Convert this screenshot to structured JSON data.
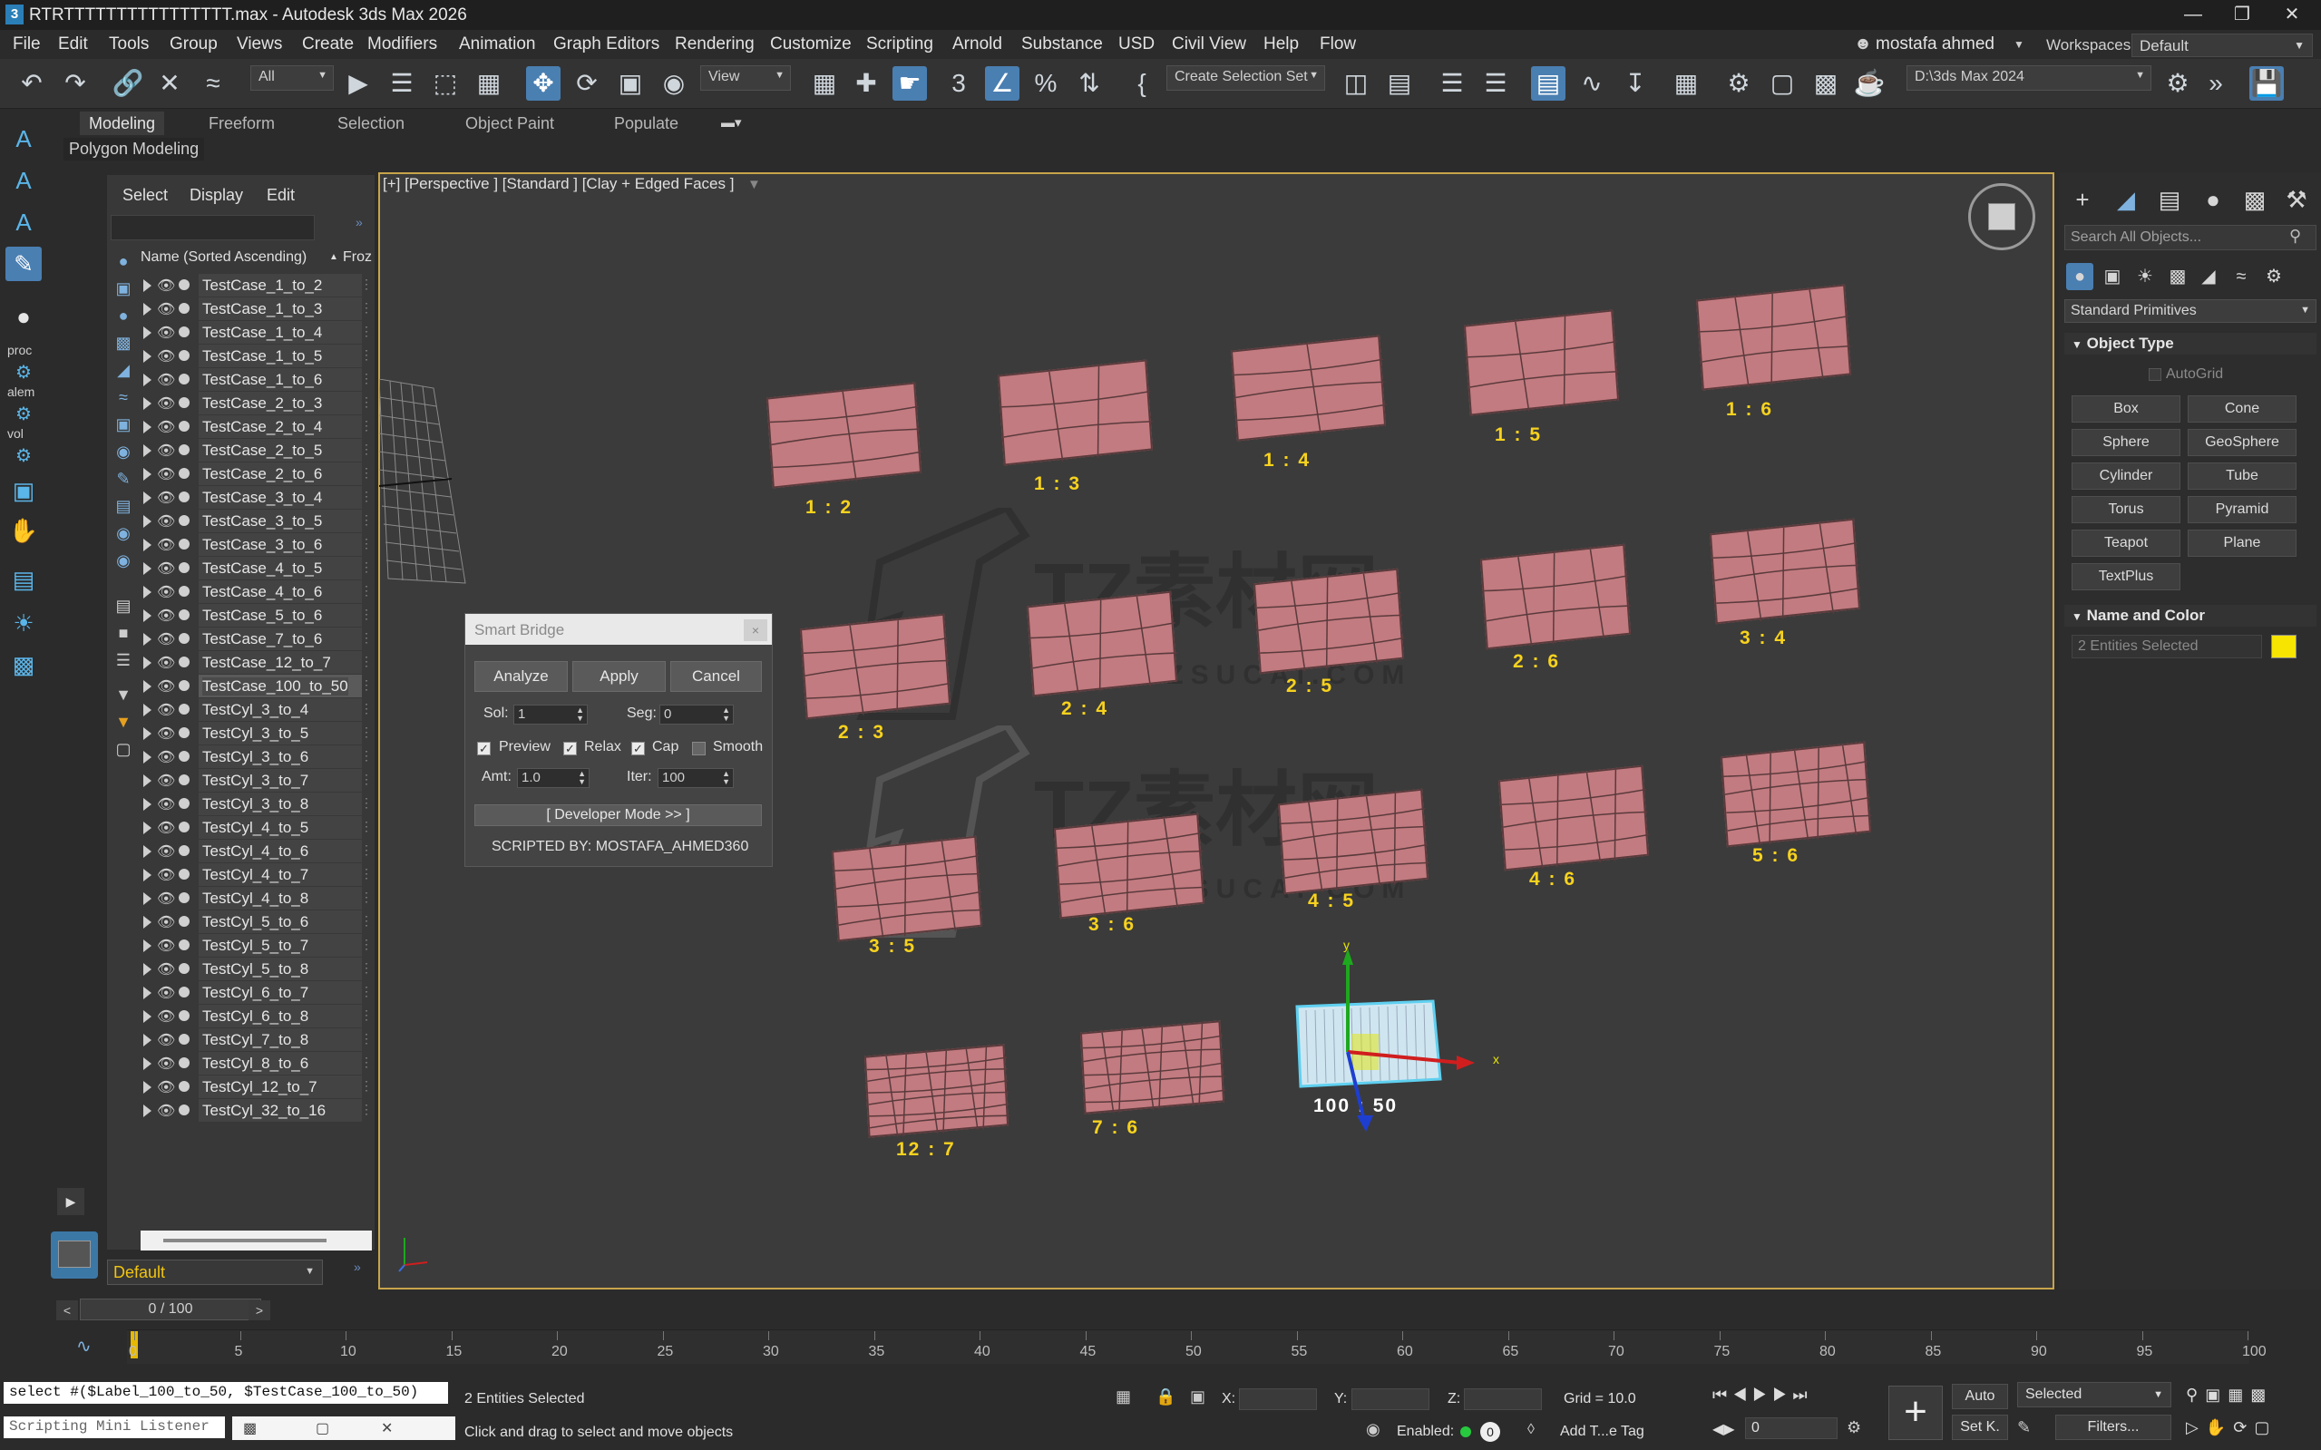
{
  "window": {
    "title": "RTRTTTTTTTTTTTTTTTT.max - Autodesk 3ds Max 2026",
    "minimize": "—",
    "restore": "❐",
    "close": "✕"
  },
  "menu": [
    "File",
    "Edit",
    "Tools",
    "Group",
    "Views",
    "Create",
    "Modifiers",
    "Animation",
    "Graph Editors",
    "Rendering",
    "Customize",
    "Scripting",
    "Arnold",
    "Substance",
    "USD",
    "Civil View",
    "Help",
    "Flow"
  ],
  "user": "mostafa ahmed",
  "workspace": {
    "label": "Workspaces:",
    "value": "Default"
  },
  "toolbar": {
    "filter": "All",
    "view": "View",
    "selection_set": "Create Selection Set",
    "project_path": "D:\\3ds Max 2024"
  },
  "ribbon": {
    "tabs": [
      "Modeling",
      "Freeform",
      "Selection",
      "Object Paint",
      "Populate"
    ],
    "panel": "Polygon Modeling"
  },
  "left_strip": {
    "proc": "proc",
    "alem": "alem",
    "vol": "vol"
  },
  "explorer": {
    "tabs": [
      "Select",
      "Display",
      "Edit"
    ],
    "header": "Name (Sorted Ascending)",
    "froz": "Froz",
    "rows": [
      "TestCase_1_to_2",
      "TestCase_1_to_3",
      "TestCase_1_to_4",
      "TestCase_1_to_5",
      "TestCase_1_to_6",
      "TestCase_2_to_3",
      "TestCase_2_to_4",
      "TestCase_2_to_5",
      "TestCase_2_to_6",
      "TestCase_3_to_4",
      "TestCase_3_to_5",
      "TestCase_3_to_6",
      "TestCase_4_to_5",
      "TestCase_4_to_6",
      "TestCase_5_to_6",
      "TestCase_7_to_6",
      "TestCase_12_to_7",
      "TestCase_100_to_50",
      "TestCyl_3_to_4",
      "TestCyl_3_to_5",
      "TestCyl_3_to_6",
      "TestCyl_3_to_7",
      "TestCyl_3_to_8",
      "TestCyl_4_to_5",
      "TestCyl_4_to_6",
      "TestCyl_4_to_7",
      "TestCyl_4_to_8",
      "TestCyl_5_to_6",
      "TestCyl_5_to_7",
      "TestCyl_5_to_8",
      "TestCyl_6_to_7",
      "TestCyl_6_to_8",
      "TestCyl_7_to_8",
      "TestCyl_8_to_6",
      "TestCyl_12_to_7",
      "TestCyl_32_to_16"
    ],
    "layer": "Default"
  },
  "viewport": {
    "label": "[+] [Perspective ] [Standard ] [Clay + Edged Faces ]",
    "ratios": [
      "1 : 2",
      "1 : 3",
      "1 : 4",
      "1 : 5",
      "1 : 6",
      "2 : 3",
      "2 : 4",
      "2 : 5",
      "2 : 6",
      "3 : 4",
      "3 : 5",
      "3 : 6",
      "4 : 5",
      "4 : 6",
      "5 : 6",
      "12 : 7",
      "7 : 6",
      "100 : 50"
    ],
    "watermark": "TZ素材网",
    "watermark_sub": "TZSUCAI.COM",
    "gizmo_y": "y",
    "gizmo_x": "x"
  },
  "dialog": {
    "title": "Smart Bridge",
    "close": "×",
    "analyze": "Analyze",
    "apply": "Apply",
    "cancel": "Cancel",
    "sol_label": "Sol:",
    "sol_value": "1",
    "seg_label": "Seg:",
    "seg_value": "0",
    "preview": "Preview",
    "relax": "Relax",
    "cap": "Cap",
    "smooth": "Smooth",
    "amt_label": "Amt:",
    "amt_value": "1.0",
    "iter_label": "Iter:",
    "iter_value": "100",
    "dev_mode": "[ Developer Mode >> ]",
    "credit": "SCRIPTED BY: MOSTAFA_AHMED360"
  },
  "command_panel": {
    "search_placeholder": "Search All Objects...",
    "category": "Standard Primitives",
    "object_type": "Object Type",
    "autogrid": "AutoGrid",
    "buttons": [
      "Box",
      "Cone",
      "Sphere",
      "GeoSphere",
      "Cylinder",
      "Tube",
      "Torus",
      "Pyramid",
      "Teapot",
      "Plane",
      "TextPlus"
    ],
    "name_color": "Name and Color",
    "name_value": "2 Entities Selected",
    "object_color": "#f7e400"
  },
  "timeline": {
    "frame": "0 / 100",
    "ticks": [
      "0",
      "5",
      "10",
      "15",
      "20",
      "25",
      "30",
      "35",
      "40",
      "45",
      "50",
      "55",
      "60",
      "65",
      "70",
      "75",
      "80",
      "85",
      "90",
      "95",
      "100"
    ]
  },
  "status": {
    "listener_cmd": "select #($Label_100_to_50, $TestCase_100_to_50)",
    "listener_label": "Scripting Mini Listener",
    "selected": "2 Entities Selected",
    "prompt": "Click and drag to select and move objects",
    "x_label": "X:",
    "y_label": "Y:",
    "z_label": "Z:",
    "grid": "Grid = 10.0",
    "enabled": "Enabled:",
    "enabled_value": "0",
    "add_tag": "Add T...e Tag",
    "auto": "Auto",
    "set_key": "Set K.",
    "selected_mode": "Selected",
    "filters": "Filters...",
    "frame_value": "0"
  }
}
